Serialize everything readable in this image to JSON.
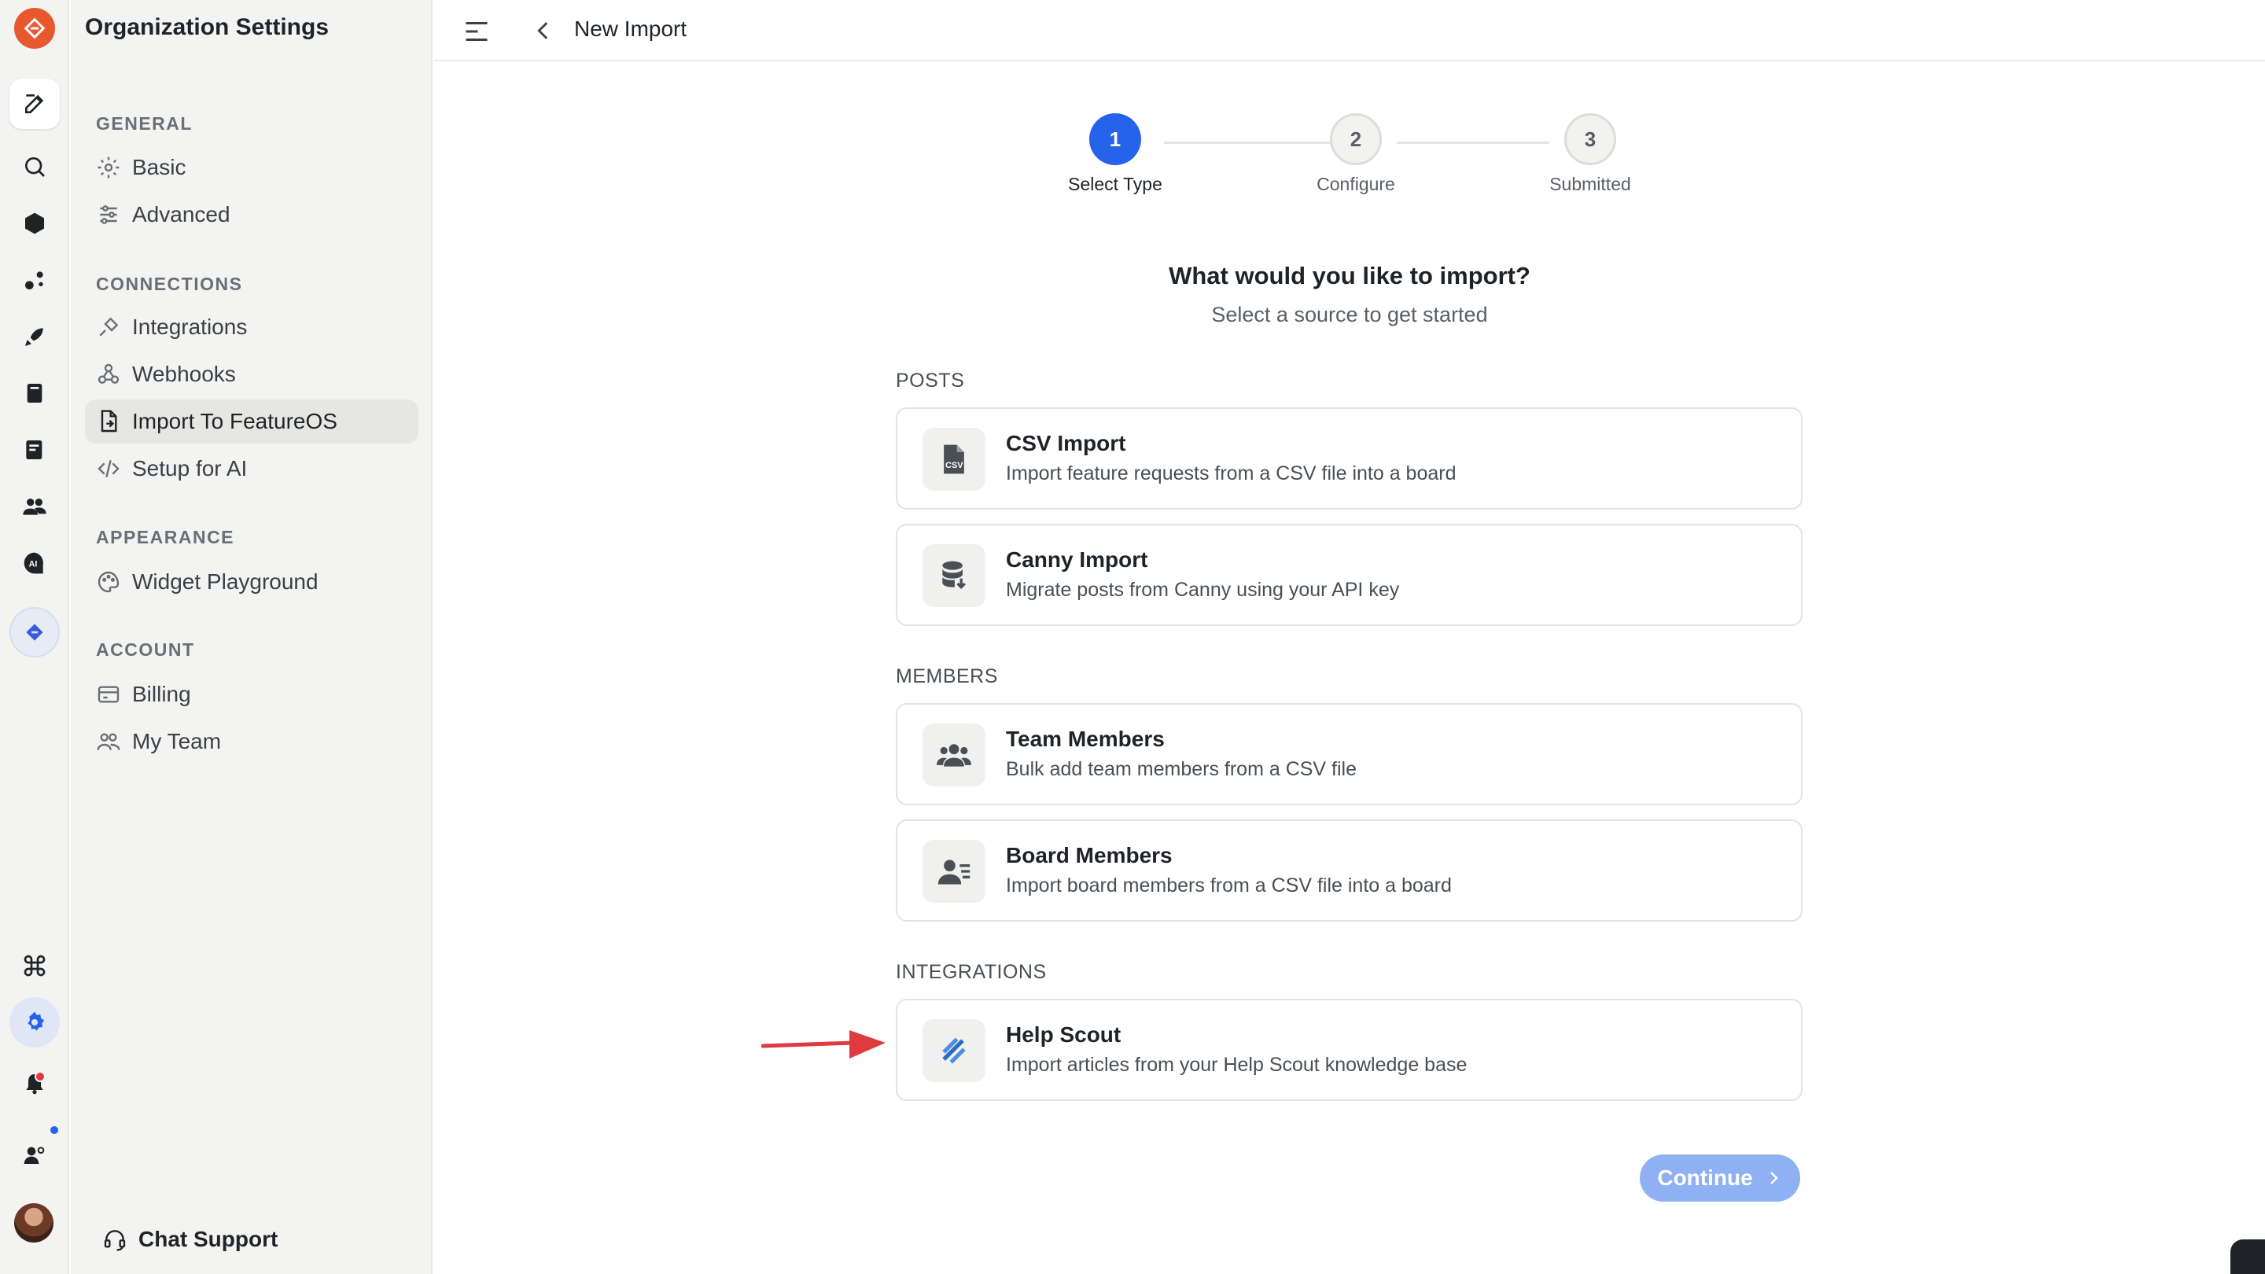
{
  "sidebar": {
    "title": "Organization Settings",
    "sections": {
      "general": "GENERAL",
      "connections": "CONNECTIONS",
      "appearance": "APPEARANCE",
      "account": "ACCOUNT"
    },
    "items": {
      "basic": "Basic",
      "advanced": "Advanced",
      "integrations": "Integrations",
      "webhooks": "Webhooks",
      "import": "Import To FeatureOS",
      "setup_ai": "Setup for AI",
      "widget": "Widget Playground",
      "billing": "Billing",
      "team": "My Team"
    },
    "chat_support": "Chat Support"
  },
  "header": {
    "title": "New Import"
  },
  "stepper": {
    "steps": [
      {
        "number": "1",
        "label": "Select Type"
      },
      {
        "number": "2",
        "label": "Configure"
      },
      {
        "number": "3",
        "label": "Submitted"
      }
    ]
  },
  "main": {
    "heading": "What would you like to import?",
    "subheading": "Select a source to get started",
    "groups": {
      "posts": "POSTS",
      "members": "MEMBERS",
      "integrations": "INTEGRATIONS"
    },
    "cards": {
      "csv": {
        "title": "CSV Import",
        "desc": "Import feature requests from a CSV file into a board"
      },
      "canny": {
        "title": "Canny Import",
        "desc": "Migrate posts from Canny using your API key"
      },
      "team": {
        "title": "Team Members",
        "desc": "Bulk add team members from a CSV file"
      },
      "board": {
        "title": "Board Members",
        "desc": "Import board members from a CSV file into a board"
      },
      "helpscout": {
        "title": "Help Scout",
        "desc": "Import articles from your Help Scout knowledge base"
      }
    },
    "continue_label": "Continue"
  },
  "colors": {
    "accent": "#2563eb",
    "button": "#8fb0f2",
    "logo": "#e8582f",
    "arrow": "#e0393e"
  }
}
